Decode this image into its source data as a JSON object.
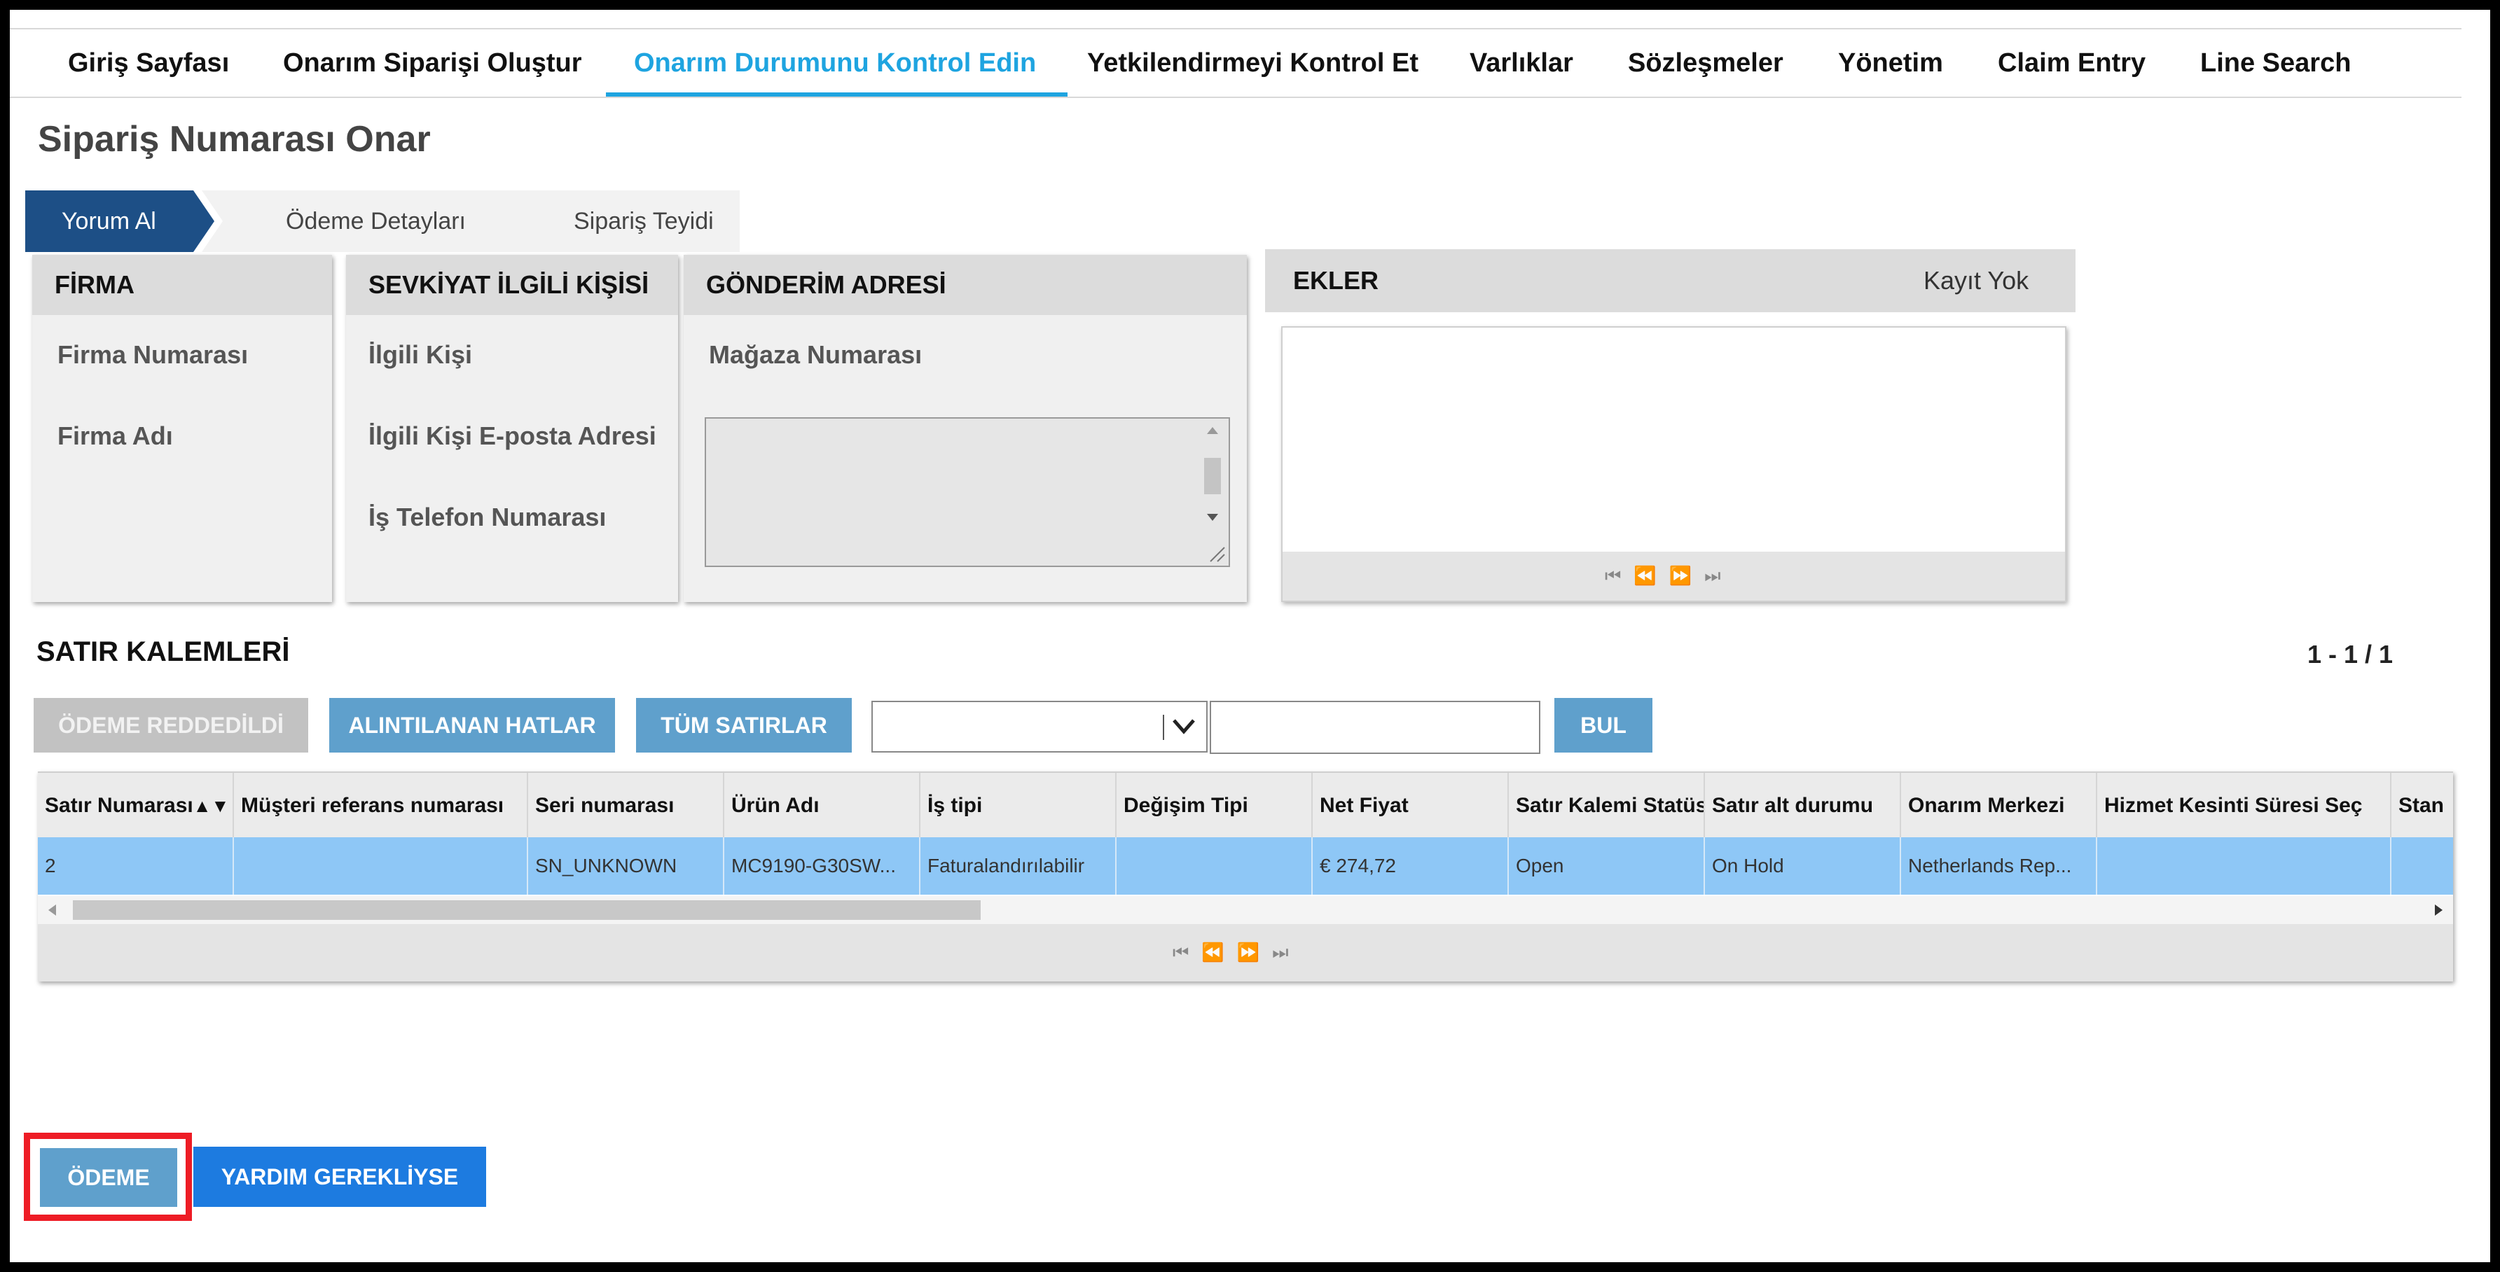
{
  "nav": {
    "items": [
      {
        "label": "Giriş Sayfası"
      },
      {
        "label": "Onarım Siparişi Oluştur"
      },
      {
        "label": "Onarım Durumunu Kontrol Edin"
      },
      {
        "label": "Yetkilendirmeyi Kontrol Et"
      },
      {
        "label": "Varlıklar"
      },
      {
        "label": "Sözleşmeler"
      },
      {
        "label": "Yönetim"
      },
      {
        "label": "Claim Entry"
      },
      {
        "label": "Line Search"
      }
    ],
    "active_color": "#1ea4e0"
  },
  "page_title": "Sipariş Numarası Onar",
  "steps": [
    {
      "label": "Yorum Al"
    },
    {
      "label": "Ödeme Detayları"
    },
    {
      "label": "Sipariş Teyidi"
    }
  ],
  "firma": {
    "title": "FİRMA",
    "fields": [
      "Firma Numarası",
      "Firma Adı"
    ]
  },
  "sevkiyat": {
    "title": "SEVKİYAT İLGİLİ KİŞİSİ",
    "fields": [
      "İlgili Kişi",
      "İlgili Kişi E-posta Adresi",
      "İş Telefon Numarası"
    ]
  },
  "gonderim": {
    "title": "GÖNDERİM ADRESİ",
    "fields": [
      "Mağaza Numarası"
    ]
  },
  "ekler": {
    "title": "EKLER",
    "count": "Kayıt Yok"
  },
  "line_items": {
    "title": "SATIR KALEMLERİ",
    "range": "1 - 1 / 1",
    "buttons": {
      "rejected": "ÖDEME REDDEDİLDİ",
      "quoted": "ALINTILANAN HATLAR",
      "all": "TÜM SATIRLAR",
      "find": "BUL"
    },
    "search_value": "",
    "columns": [
      "Satır Numarası",
      "Müşteri referans numarası",
      "Seri numarası",
      "Ürün Adı",
      "İş tipi",
      "Değişim Tipi",
      "Net Fiyat",
      "Satır Kalemi Statüs",
      "Satır alt durumu",
      "Onarım Merkezi",
      "Hizmet Kesinti Süresi Seç",
      "Stan"
    ],
    "rows": [
      [
        "2",
        "",
        "SN_UNKNOWN",
        "MC9190-G30SW...",
        "Faturalandırılabilir",
        "",
        "€ 274,72",
        "Open",
        "On Hold",
        "Netherlands Rep...",
        "",
        ""
      ]
    ],
    "row_color": "#8ec7f6"
  },
  "footer": {
    "pay": "ÖDEME",
    "help": "YARDIM GEREKLİYSE"
  },
  "highlight_color": "#ee1c25"
}
